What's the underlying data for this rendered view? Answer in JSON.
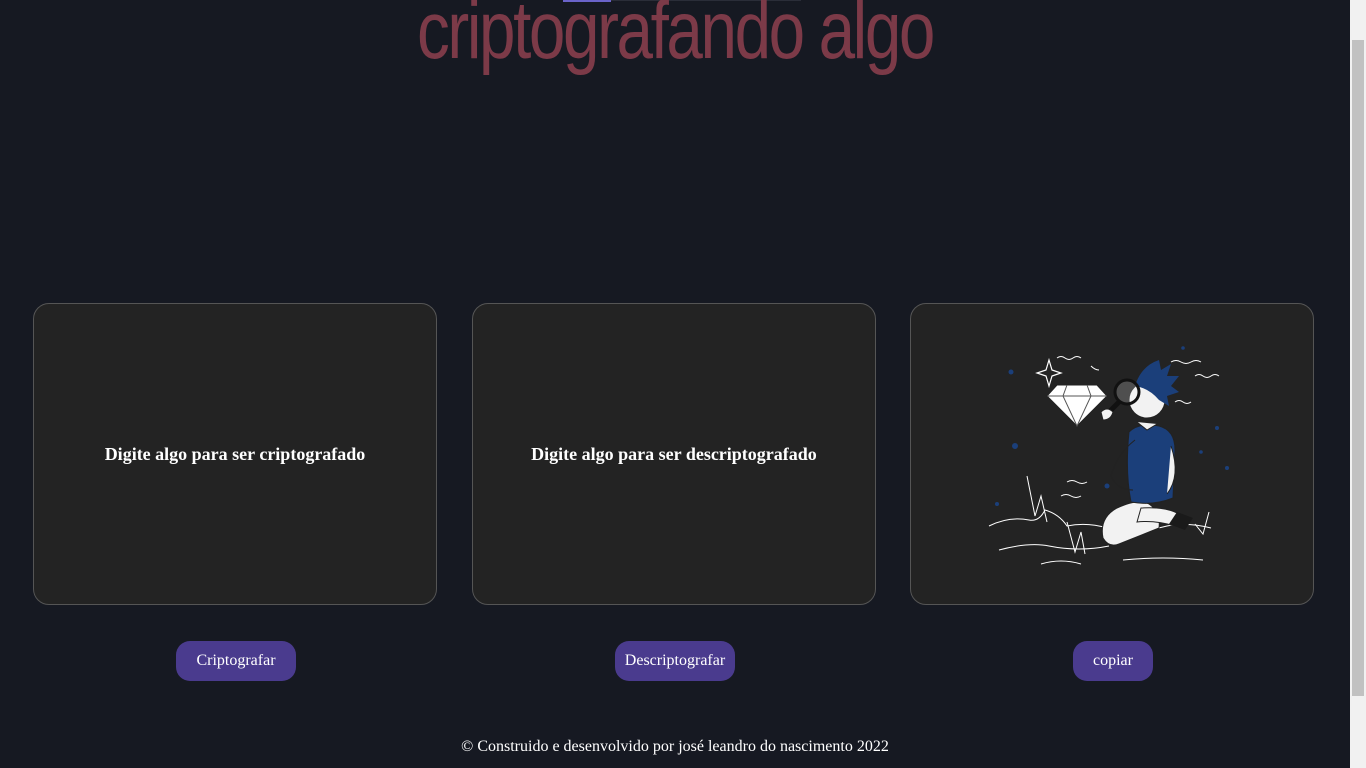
{
  "header": {
    "title": "criptografando algo"
  },
  "panels": {
    "encrypt": {
      "prompt": "Digite algo para ser criptografado"
    },
    "decrypt": {
      "prompt": "Digite algo para ser descriptografado"
    },
    "output": {
      "illustration": "person-with-magnifier-and-diamond"
    }
  },
  "buttons": {
    "encrypt_label": "Criptografar",
    "decrypt_label": "Descriptografar",
    "copy_label": "copiar"
  },
  "footer": {
    "text": "© Construido e desenvolvido por josé leandro do nascimento 2022"
  },
  "colors": {
    "background": "#161922",
    "title": "#7c3a48",
    "card": "#232323",
    "button": "#4a3b8e",
    "illustration_accent": "#1b3f7a"
  }
}
